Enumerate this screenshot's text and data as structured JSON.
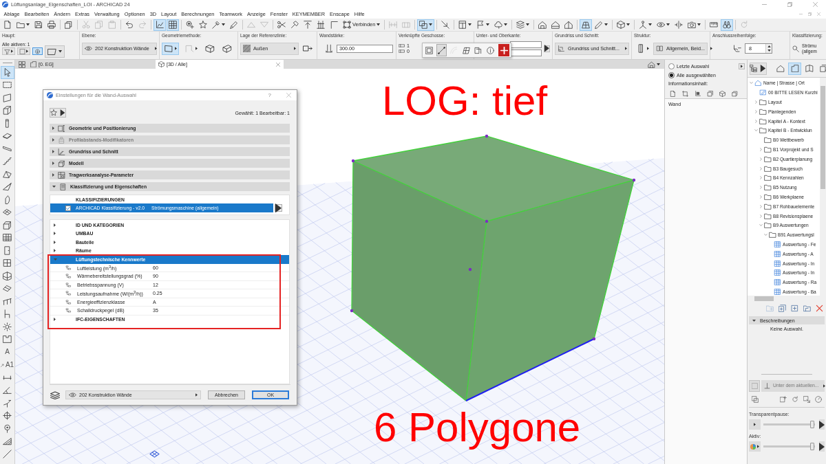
{
  "window": {
    "title": "Lüftungsanlage_Eigenschaften_LOI - ARCHICAD 24"
  },
  "menu": [
    "Ablage",
    "Bearbeiten",
    "Ändern",
    "Extras",
    "Verwaltung",
    "Optionen",
    "3D",
    "Layout",
    "Berechnungen",
    "Teamwork",
    "Anzeige",
    "Fenster",
    "KEYMEMBER",
    "Enscape",
    "Hilfe"
  ],
  "toolbar": [
    [
      {
        "kind": "new",
        "selected": false,
        "disabled": false
      },
      {
        "kind": "open",
        "selected": false,
        "disabled": false,
        "dropdown": true
      },
      {
        "kind": "save",
        "selected": false,
        "disabled": false
      },
      {
        "kind": "print",
        "selected": false,
        "disabled": false
      }
    ],
    [
      {
        "kind": "publish",
        "selected": false,
        "disabled": false
      }
    ],
    [
      {
        "kind": "cut",
        "selected": false,
        "disabled": true
      },
      {
        "kind": "copy",
        "selected": false,
        "disabled": true
      },
      {
        "kind": "paste",
        "selected": false,
        "disabled": true
      }
    ],
    [
      {
        "kind": "undo",
        "selected": false,
        "disabled": false
      },
      {
        "kind": "redo",
        "selected": false,
        "disabled": true
      }
    ],
    [
      {
        "kind": "plan",
        "selected": true,
        "disabled": false
      },
      {
        "kind": "grid",
        "selected": true,
        "disabled": false
      }
    ],
    [
      {
        "kind": "pin",
        "selected": false,
        "disabled": false
      },
      {
        "kind": "star",
        "selected": false,
        "disabled": false
      },
      {
        "kind": "eyedropper",
        "selected": false,
        "disabled": false,
        "dropdown": true
      },
      {
        "kind": "pipette",
        "selected": false,
        "disabled": false
      }
    ],
    [
      {
        "kind": "up",
        "selected": false,
        "disabled": true
      },
      {
        "kind": "down",
        "selected": false,
        "disabled": true
      }
    ],
    [
      {
        "kind": "trim",
        "selected": false,
        "disabled": false
      },
      {
        "kind": "hammer",
        "selected": false,
        "disabled": false
      },
      {
        "kind": "align",
        "selected": false,
        "disabled": false
      },
      {
        "kind": "distribute",
        "selected": false,
        "disabled": false
      },
      {
        "kind": "corner",
        "selected": false,
        "disabled": false
      },
      {
        "kind": "connect",
        "label": "Verbinden",
        "selected": false,
        "disabled": false,
        "dropdown": true
      }
    ],
    [
      {
        "kind": "split",
        "selected": false,
        "disabled": true
      },
      {
        "kind": "adjust",
        "selected": false,
        "disabled": true
      }
    ],
    [
      {
        "kind": "overlap",
        "selected": true,
        "disabled": false,
        "dropdown": true
      }
    ],
    [
      {
        "kind": "cursor",
        "selected": false,
        "disabled": false
      }
    ],
    [
      {
        "kind": "page",
        "selected": false,
        "disabled": false,
        "dropdown": true
      },
      {
        "kind": "flag",
        "selected": false,
        "disabled": false,
        "dropdown": true
      },
      {
        "kind": "cloud",
        "selected": false,
        "disabled": false,
        "dropdown": true
      }
    ],
    [
      {
        "kind": "stack",
        "selected": false,
        "disabled": false,
        "dropdown": true
      }
    ],
    [
      {
        "kind": "house-a",
        "selected": false,
        "disabled": false
      },
      {
        "kind": "house-b",
        "selected": false,
        "disabled": false
      },
      {
        "kind": "house-c",
        "selected": false,
        "disabled": false
      }
    ],
    [
      {
        "kind": "perspective",
        "selected": true,
        "disabled": false
      },
      {
        "kind": "pencil",
        "selected": false,
        "disabled": false,
        "dropdown": true
      }
    ],
    [
      {
        "kind": "cube",
        "selected": false,
        "disabled": false,
        "dropdown": true
      }
    ],
    [
      {
        "kind": "tripod",
        "selected": false,
        "disabled": false,
        "dropdown": true
      },
      {
        "kind": "orbit",
        "selected": false,
        "disabled": false,
        "dropdown": true
      },
      {
        "kind": "section",
        "selected": false,
        "disabled": false
      },
      {
        "kind": "camera",
        "selected": false,
        "disabled": false,
        "dropdown": true
      }
    ],
    [
      {
        "kind": "ruler",
        "selected": false,
        "disabled": false
      },
      {
        "kind": "binoculars",
        "selected": true,
        "disabled": false
      }
    ],
    [
      {
        "kind": "refresh",
        "selected": false,
        "disabled": true
      }
    ]
  ],
  "info_box": {
    "groups": [
      {
        "kind": "main",
        "label": "Haupt:",
        "text": "Alle aktiven: 1",
        "options": [
          {
            "selected": false
          },
          {
            "selected": false
          },
          {
            "selected": true
          }
        ]
      },
      {
        "kind": "layer",
        "label": "Ebene:",
        "value": "202 Konstruktion Wände"
      },
      {
        "kind": "geometry",
        "label": "Geometriemethode:",
        "options": [
          {
            "selected": true,
            "disabled": false
          },
          {
            "selected": false,
            "disabled": true
          },
          {
            "selected": false,
            "disabled": false
          },
          {
            "selected": false,
            "disabled": false
          }
        ]
      },
      {
        "kind": "reference",
        "label": "Lage der Referenzlinie:",
        "value": "Außen"
      },
      {
        "kind": "input",
        "label": "Wandstärke:",
        "value": "300.00"
      },
      {
        "kind": "stories",
        "label": "Verknüpfte Geschosse:",
        "values": [
          "1",
          "0"
        ]
      },
      {
        "kind": "heights",
        "label": "Unter- und Oberkante:"
      },
      {
        "kind": "display",
        "label": "Grundriss und Schnitt:",
        "value": "Grundriss und Schnitt..."
      },
      {
        "kind": "structure",
        "label": "Struktur:",
        "value": "Allgemein, Beid..."
      },
      {
        "kind": "spinner",
        "label": "Anschlussreihenfolge:",
        "value": "8"
      },
      {
        "kind": "classification",
        "label": "Klassifizierung:",
        "lines": [
          "Strömu",
          "(allgem"
        ]
      }
    ]
  },
  "pet_palette": {
    "buttons": [
      {
        "selected": false,
        "disabled": false
      },
      {
        "selected": true,
        "disabled": false
      },
      {
        "selected": false,
        "disabled": true
      },
      {
        "selected": false,
        "disabled": false
      },
      {
        "selected": false,
        "disabled": false
      },
      {
        "selected": false,
        "disabled": false
      },
      {
        "selected": false,
        "disabled": false
      }
    ]
  },
  "tabs": [
    {
      "kind": "plan",
      "label": "[0. EG]",
      "selected": false
    },
    {
      "kind": "model",
      "label": "[3D / Alle]",
      "selected": true
    }
  ],
  "toolbox": [
    {
      "kind": "pointer",
      "selected": true
    },
    {
      "kind": "marquee",
      "selected": false
    },
    {
      "kind": "wall",
      "selected": false
    },
    {
      "kind": "wall-corner",
      "selected": false
    },
    {
      "kind": "column",
      "selected": false
    },
    {
      "kind": "slab",
      "selected": false
    },
    {
      "kind": "beam",
      "selected": false
    },
    {
      "kind": "stair",
      "selected": false
    },
    {
      "kind": "roof",
      "selected": false
    },
    {
      "kind": "shell",
      "selected": false
    },
    {
      "kind": "morph",
      "selected": false
    },
    {
      "kind": "mesh",
      "selected": false
    },
    {
      "kind": "box",
      "selected": false
    },
    {
      "kind": "curtain-wall",
      "selected": false
    },
    {
      "kind": "door",
      "selected": false
    },
    {
      "kind": "window",
      "selected": false
    },
    {
      "kind": "corner-window",
      "selected": false
    },
    {
      "kind": "skylight",
      "selected": false
    },
    {
      "kind": "railing",
      "selected": false
    },
    {
      "kind": "chair",
      "selected": false
    },
    {
      "kind": "lamp",
      "selected": false
    },
    {
      "kind": "zone",
      "selected": false
    },
    {
      "kind": "text",
      "glyph": "A",
      "selected": false
    },
    {
      "kind": "label",
      "glyph": "A1",
      "selected": false
    },
    {
      "kind": "dimension",
      "selected": false
    },
    {
      "kind": "angle",
      "selected": false
    },
    {
      "kind": "radial",
      "selected": false
    },
    {
      "kind": "crosshair",
      "selected": false
    },
    {
      "kind": "marker",
      "selected": false
    },
    {
      "kind": "hatch",
      "selected": false
    },
    {
      "kind": "line",
      "selected": false
    }
  ],
  "view": {
    "heading": "LOG: tief",
    "caption": "6 Polygone"
  },
  "dialog": {
    "title": "Einstellungen für die Wand-Auswahl",
    "help": "?",
    "selection": "Gewählt: 1 Bearbeitbar: 1",
    "panels": [
      {
        "kind": "geometry",
        "label": "Geometrie und Positionierung",
        "expanded": false,
        "disabled": false
      },
      {
        "kind": "profile",
        "label": "Profilabstands-Modifikatoren",
        "expanded": false,
        "disabled": true
      },
      {
        "kind": "plan",
        "label": "Grundriss und Schnitt",
        "expanded": false,
        "disabled": false
      },
      {
        "kind": "model",
        "label": "Modell",
        "expanded": false,
        "disabled": false
      },
      {
        "kind": "structural",
        "label": "Tragwerksanalyse-Parameter",
        "expanded": false,
        "disabled": false
      },
      {
        "kind": "classification",
        "label": "Klassifizierung und Eigenschaften",
        "expanded": true,
        "disabled": false
      }
    ],
    "classifications": {
      "heading": "KLASSIFIZIERUNGEN",
      "rows": [
        {
          "system": "ARCHICAD Klassifizierung - v2.0",
          "value": "Strömungsmaschine (allgemein)",
          "checked": true,
          "selected": true
        }
      ]
    },
    "properties": [
      {
        "label": "ID UND KATEGORIEN",
        "expanded": false,
        "selected": false
      },
      {
        "label": "UMBAU",
        "expanded": false,
        "selected": false
      },
      {
        "label": "Bauteile",
        "expanded": false,
        "selected": false
      },
      {
        "label": "Räume",
        "expanded": false,
        "selected": false
      },
      {
        "label": "Lüftungstechnische Kennwerte",
        "expanded": true,
        "selected": true,
        "children": [
          {
            "name": "Luftleistung (m$^{3}$/h)",
            "value": "60"
          },
          {
            "name": "Wärmebereitstellungsgrad (%)",
            "value": "90"
          },
          {
            "name": "Betriebsspannung (V)",
            "value": "12"
          },
          {
            "name": "Leistungsaufnahme (W/(m$^{3}$/h))",
            "value": "0.25"
          },
          {
            "name": "Energieeffizienzklasse",
            "value": "A"
          },
          {
            "name": "Schalldruckpegel (dB)",
            "value": "35"
          }
        ]
      },
      {
        "label": "IFC-EIGENSCHAFTEN",
        "expanded": false,
        "selected": false
      }
    ],
    "layer": "202 Konstruktion Wände",
    "buttons": [
      {
        "label": "Abbrechen",
        "default": false
      },
      {
        "label": "OK",
        "default": true
      }
    ]
  },
  "info_panel": {
    "options": [
      {
        "label": "Letzte Auswahl",
        "selected": false
      },
      {
        "label": "Alle ausgewählten",
        "selected": true
      }
    ],
    "content_label": "Informationsinhalt:",
    "items": [
      "Wand"
    ]
  },
  "navigator": {
    "maps": [
      {
        "kind": "project",
        "selected": false
      },
      {
        "kind": "views",
        "selected": true
      },
      {
        "kind": "layouts",
        "selected": false
      },
      {
        "kind": "publisher",
        "selected": false
      }
    ],
    "tree": [
      {
        "kind": "project",
        "label": "Name | Strasse | Ort",
        "expanded": true,
        "children": [
          {
            "kind": "note",
            "label": "00 BITTE LESEN Kurzhi"
          },
          {
            "kind": "folder",
            "label": "Layout",
            "expanded": false
          },
          {
            "kind": "folder",
            "label": "Planlegenden",
            "expanded": false
          },
          {
            "kind": "folder",
            "label": "Kapitel A - Kontext",
            "expanded": false
          },
          {
            "kind": "folder",
            "label": "Kapitel B - Entwicklun",
            "expanded": true,
            "children": [
              {
                "kind": "folder",
                "label": "B0 Wettbewerb"
              },
              {
                "kind": "folder",
                "label": "B1 Vorprojekt und S",
                "expanded": false
              },
              {
                "kind": "folder",
                "label": "B2 Quartierplanung",
                "expanded": false
              },
              {
                "kind": "folder",
                "label": "B3 Baugesuch",
                "expanded": false
              },
              {
                "kind": "folder",
                "label": "B4 Kennzahlen",
                "expanded": false
              },
              {
                "kind": "folder",
                "label": "B5 Nutzung",
                "expanded": false
              },
              {
                "kind": "folder",
                "label": "B6 Werkplaene",
                "expanded": false
              },
              {
                "kind": "folder",
                "label": "B7 Rohbauelemente",
                "expanded": false
              },
              {
                "kind": "folder",
                "label": "B8 Revisionsplaene",
                "expanded": false
              },
              {
                "kind": "folder",
                "label": "B9 Auswertungen",
                "expanded": true,
                "children": [
                  {
                    "kind": "folder",
                    "label": "B91 Auswertungsl",
                    "expanded": true,
                    "children": [
                      {
                        "kind": "schedule",
                        "label": "Auswertung - Fe"
                      },
                      {
                        "kind": "schedule",
                        "label": "Auswertung - A"
                      },
                      {
                        "kind": "schedule",
                        "label": "Auswertung - In"
                      },
                      {
                        "kind": "schedule",
                        "label": "Auswertung - In"
                      },
                      {
                        "kind": "schedule",
                        "label": "Auswertung - Ra"
                      },
                      {
                        "kind": "schedule",
                        "label": "Auswertung - Ba"
                      }
                    ]
                  }
                ]
              }
            ]
          }
        ]
      }
    ]
  },
  "descriptions": {
    "heading": "Beschreibungen",
    "expanded": true,
    "text": "Keine Auswahl."
  },
  "layers": {
    "placement": {
      "value": "Unter dem aktuellen...",
      "disabled": true
    },
    "sliders": [
      {
        "kind": "plain",
        "label": "Transparentpause:",
        "level": 0.95
      },
      {
        "kind": "pie",
        "label": "Aktiv:",
        "level": 0.95
      }
    ]
  }
}
